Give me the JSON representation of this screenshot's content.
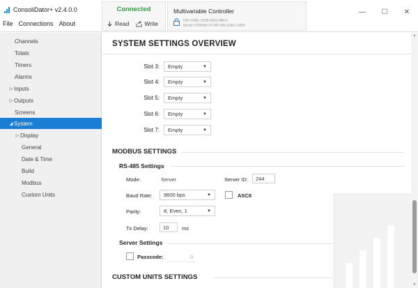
{
  "app": {
    "title": "ConsoliDator+ v2.4.0.0",
    "menu": [
      "File",
      "Connections",
      "About"
    ]
  },
  "connection": {
    "status": "Connected",
    "read_label": "Read",
    "write_label": "Write",
    "status_color": "#2e9e3e"
  },
  "device": {
    "title": "Multivariable Controller",
    "line1": "HID: E0EL-5258-0902-9BFG",
    "line2": "Model: PD9000-XY-4PI-8AI-10AO-10RY"
  },
  "window_controls": {
    "minimize": "—",
    "maximize": "☐",
    "close": "✕"
  },
  "sidebar": {
    "items": [
      {
        "label": "Channels",
        "caret": ""
      },
      {
        "label": "Totals",
        "caret": ""
      },
      {
        "label": "Timers",
        "caret": ""
      },
      {
        "label": "Alarms",
        "caret": ""
      },
      {
        "label": "Inputs",
        "caret": "▷"
      },
      {
        "label": "Outputs",
        "caret": "▷"
      },
      {
        "label": "Screens",
        "caret": ""
      },
      {
        "label": "System",
        "caret": "◢"
      },
      {
        "label": "Display",
        "caret": "▷"
      },
      {
        "label": "General",
        "caret": ""
      },
      {
        "label": "Date & Time",
        "caret": ""
      },
      {
        "label": "Build",
        "caret": ""
      },
      {
        "label": "Modbus",
        "caret": ""
      },
      {
        "label": "Custom Units",
        "caret": ""
      }
    ],
    "active_color": "#1a7fd4"
  },
  "main": {
    "title": "SYSTEM SETTINGS OVERVIEW",
    "slots": [
      {
        "label": "Slot 3:",
        "value": "Empty"
      },
      {
        "label": "Slot 4:",
        "value": "Empty"
      },
      {
        "label": "Slot 5:",
        "value": "Empty"
      },
      {
        "label": "Slot 6:",
        "value": "Empty"
      },
      {
        "label": "Slot 7:",
        "value": "Empty"
      }
    ],
    "modbus": {
      "title": "MODBUS SETTINGS",
      "rs485_title": "RS-485 Settings",
      "mode_label": "Mode:",
      "mode_value": "Server",
      "server_id_label": "Server ID:",
      "server_id_value": "244",
      "baud_label": "Baud Rate:",
      "baud_value": "9600 bps",
      "ascii_label": "ASCII",
      "parity_label": "Parity:",
      "parity_value": "8, Even, 1",
      "tx_label": "Tx Delay:",
      "tx_value": "10",
      "tx_unit": "ms",
      "server_settings_title": "Server Settings",
      "passcode_label": "Passcode:",
      "passcode_value": "0"
    },
    "custom_units_title": "CUSTOM UNITS SETTINGS"
  }
}
